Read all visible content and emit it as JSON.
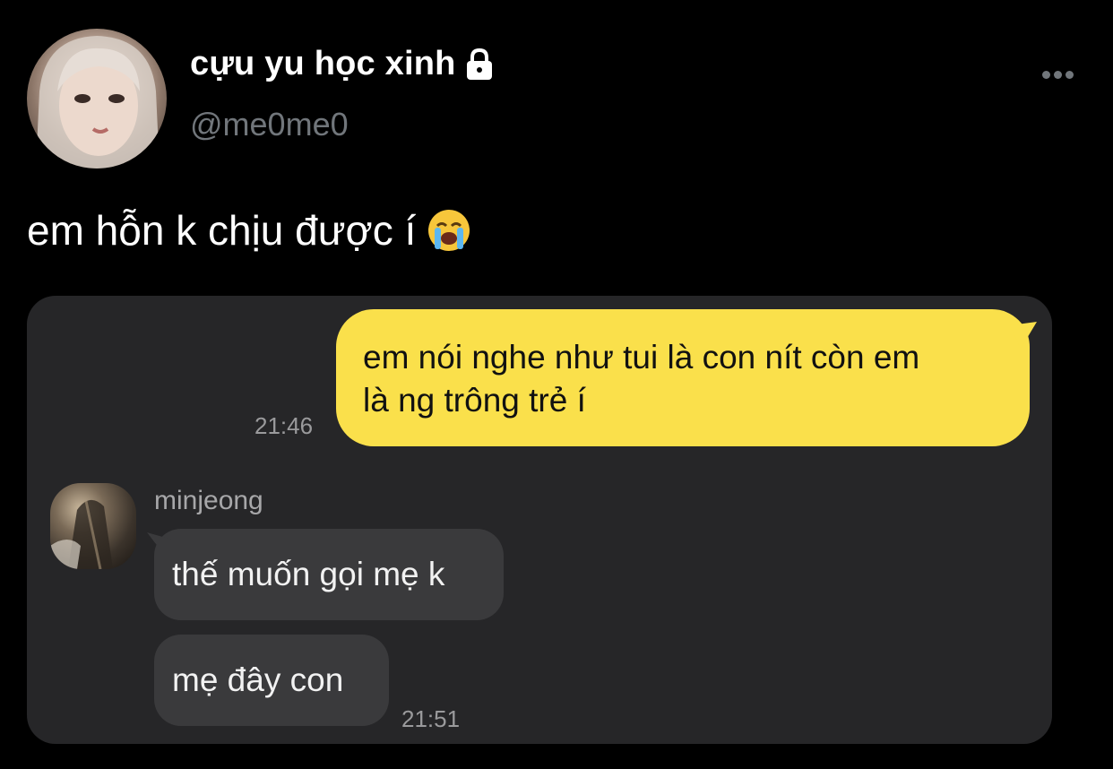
{
  "profile": {
    "display_name": "cựu yu học xinh",
    "handle": "@me0me0",
    "protected_icon": "lock-icon",
    "menu_icon": "more-horizontal-icon"
  },
  "tweet": {
    "text": "em hỗn k chịu được í",
    "emoji": "loudly-crying-face-icon"
  },
  "chat": {
    "outgoing": {
      "line1": "em nói nghe như tui là con nít còn em",
      "line2": "là ng trông trẻ í",
      "time": "21:46"
    },
    "incoming": {
      "sender": "minjeong",
      "messages": [
        "thế muốn gọi mẹ k",
        "mẹ đây con"
      ],
      "time": "21:51"
    }
  },
  "colors": {
    "background": "#000000",
    "secondary_text": "#71767b",
    "card_background": "#262628",
    "outgoing_bubble": "#fae04b",
    "incoming_bubble": "#3a3a3c"
  }
}
